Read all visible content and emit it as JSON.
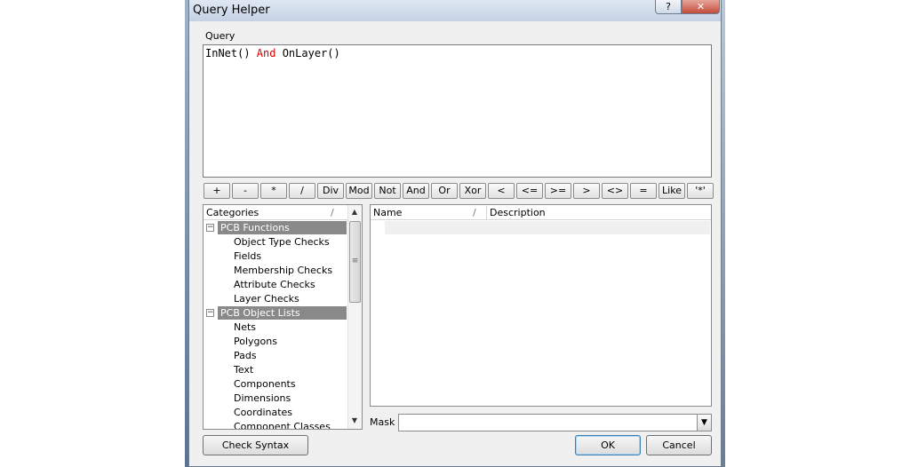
{
  "window": {
    "title": "Query Helper",
    "help_glyph": "?",
    "close_glyph": "✕"
  },
  "query": {
    "label": "Query",
    "tokens": [
      {
        "text": "InNet() ",
        "keyword": false
      },
      {
        "text": "And",
        "keyword": true
      },
      {
        "text": " OnLayer()",
        "keyword": false
      }
    ]
  },
  "operators": [
    "+",
    "-",
    "*",
    "/",
    "Div",
    "Mod",
    "Not",
    "And",
    "Or",
    "Xor",
    "<",
    "<=",
    ">=",
    ">",
    "<>",
    "=",
    "Like",
    "'*'"
  ],
  "categories": {
    "header": "Categories",
    "sort_glyph": "/",
    "groups": [
      {
        "label": "PCB Functions",
        "toggle": "−",
        "items": [
          "Object Type Checks",
          "Fields",
          "Membership Checks",
          "Attribute Checks",
          "Layer Checks"
        ]
      },
      {
        "label": "PCB Object Lists",
        "toggle": "−",
        "items": [
          "Nets",
          "Polygons",
          "Pads",
          "Text",
          "Components",
          "Dimensions",
          "Coordinates",
          "Component Classes"
        ]
      }
    ]
  },
  "list": {
    "columns": {
      "name": "Name",
      "sort_glyph": "/",
      "description": "Description"
    }
  },
  "mask": {
    "label": "Mask",
    "value": ""
  },
  "buttons": {
    "check_syntax": "Check Syntax",
    "ok": "OK",
    "cancel": "Cancel"
  },
  "colors": {
    "keyword": "#d40000",
    "group_header_bg": "#898989",
    "dialog_bg": "#f0f0f0"
  }
}
